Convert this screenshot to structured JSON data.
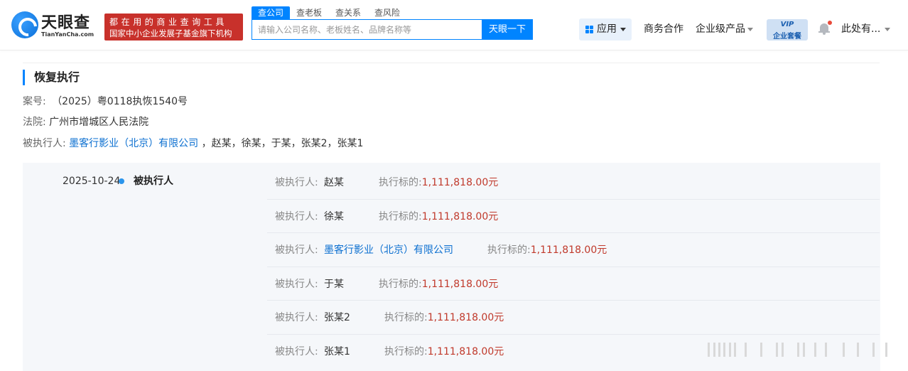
{
  "header": {
    "logo_name": "天眼查",
    "logo_sub": "TianYanCha.com",
    "slogan_line1": "都在用的商业查询工具",
    "slogan_line2": "国家中小企业发展子基金旗下机构",
    "search_tabs": [
      "查公司",
      "查老板",
      "查关系",
      "查风险"
    ],
    "search_placeholder": "请输入公司名称、老板姓名、品牌名称等",
    "search_button": "天眼一下",
    "nav_app": "应用",
    "nav_business": "商务合作",
    "nav_enterprise": "企业级产品",
    "vip_line1": "VIP",
    "vip_line2": "企业套餐",
    "user_name": "此处有..."
  },
  "section": {
    "title": "恢复执行",
    "case_label": "案号:",
    "case_no": "（2025）粤0118执恢1540号",
    "court_label": "法院:",
    "court": "广州市增城区人民法院",
    "executed_label": "被执行人:",
    "executed_company": "墨客行影业（北京）有限公司",
    "executed_others": "，赵某，徐某，于某，张某2，张某1"
  },
  "timeline": {
    "date": "2025-10-24",
    "role": "被执行人",
    "row_label": "被执行人:",
    "amount_label": "执行标的:",
    "rows": [
      {
        "name": "赵某",
        "amount": "1,111,818.00元"
      },
      {
        "name": "徐某",
        "amount": "1,111,818.00元"
      },
      {
        "name": "墨客行影业（北京）有限公司",
        "amount": "1,111,818.00元"
      },
      {
        "name": "于某",
        "amount": "1,111,818.00元"
      },
      {
        "name": "张某2",
        "amount": "1,111,818.00元"
      },
      {
        "name": "张某1",
        "amount": "1,111,818.00元"
      }
    ]
  },
  "colors": {
    "brand_blue": "#0084ff",
    "slogan_red": "#c8312b",
    "link_blue": "#0b6fd0",
    "amount_red": "#c0392b"
  },
  "icons": [
    "logo-icon",
    "grid-icon",
    "chevron-down-icon",
    "bell-icon"
  ]
}
